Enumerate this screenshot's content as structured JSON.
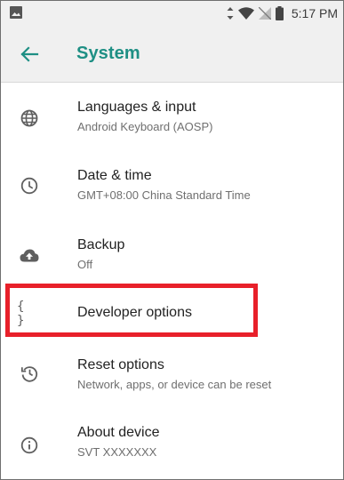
{
  "status_bar": {
    "time": "5:17 PM",
    "icons": [
      "image-icon",
      "data-arrows-icon",
      "wifi-icon",
      "no-sim-icon",
      "battery-icon"
    ]
  },
  "header": {
    "title": "System",
    "back_icon": "arrow-back-icon",
    "accent_color": "#1e8f84"
  },
  "settings": {
    "items": [
      {
        "title": "Languages & input",
        "subtitle": "Android Keyboard (AOSP)",
        "icon": "globe-icon"
      },
      {
        "title": "Date & time",
        "subtitle": "GMT+08:00 China Standard Time",
        "icon": "clock-icon"
      },
      {
        "title": "Backup",
        "subtitle": "Off",
        "icon": "cloud-upload-icon"
      },
      {
        "title": "Developer options",
        "subtitle": "",
        "icon": "braces-icon",
        "icon_text": "{ }"
      },
      {
        "title": "Reset options",
        "subtitle": "Network, apps, or device can be reset",
        "icon": "history-icon"
      },
      {
        "title": "About device",
        "subtitle": "SVT XXXXXXX",
        "icon": "info-icon"
      }
    ]
  },
  "annotation": {
    "highlight_color": "#e8202a",
    "highlighted_item": "Developer options"
  }
}
